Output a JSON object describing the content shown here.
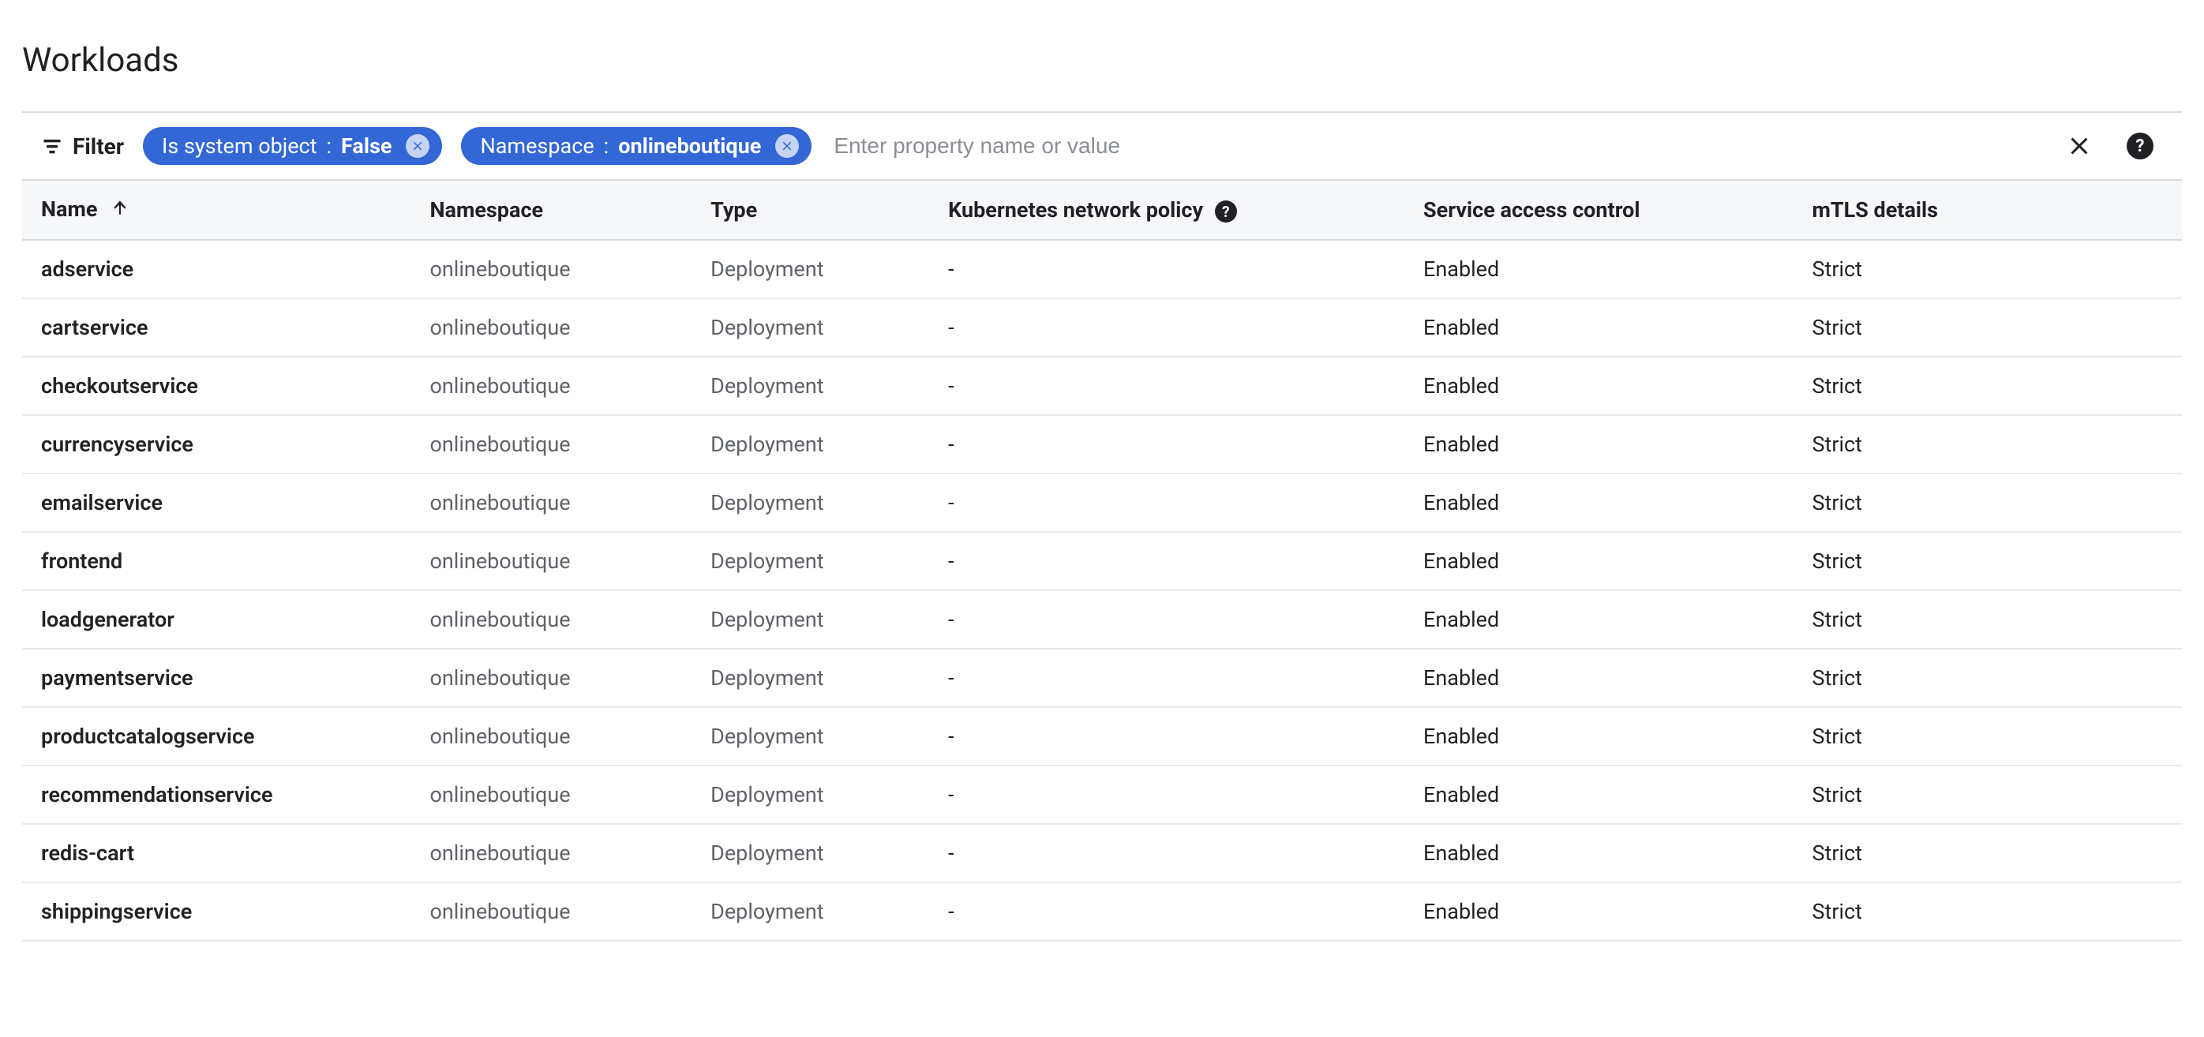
{
  "title": "Workloads",
  "filter": {
    "label": "Filter",
    "input_placeholder": "Enter property name or value",
    "chips": [
      {
        "key": "Is system object",
        "value": "False"
      },
      {
        "key": "Namespace",
        "value": "onlineboutique"
      }
    ]
  },
  "columns": {
    "name": "Name",
    "namespace": "Namespace",
    "type": "Type",
    "netpol": "Kubernetes network policy",
    "access": "Service access control",
    "mtls": "mTLS details"
  },
  "rows": [
    {
      "name": "adservice",
      "namespace": "onlineboutique",
      "type": "Deployment",
      "netpol": "-",
      "access": "Enabled",
      "mtls": "Strict"
    },
    {
      "name": "cartservice",
      "namespace": "onlineboutique",
      "type": "Deployment",
      "netpol": "-",
      "access": "Enabled",
      "mtls": "Strict"
    },
    {
      "name": "checkoutservice",
      "namespace": "onlineboutique",
      "type": "Deployment",
      "netpol": "-",
      "access": "Enabled",
      "mtls": "Strict"
    },
    {
      "name": "currencyservice",
      "namespace": "onlineboutique",
      "type": "Deployment",
      "netpol": "-",
      "access": "Enabled",
      "mtls": "Strict"
    },
    {
      "name": "emailservice",
      "namespace": "onlineboutique",
      "type": "Deployment",
      "netpol": "-",
      "access": "Enabled",
      "mtls": "Strict"
    },
    {
      "name": "frontend",
      "namespace": "onlineboutique",
      "type": "Deployment",
      "netpol": "-",
      "access": "Enabled",
      "mtls": "Strict"
    },
    {
      "name": "loadgenerator",
      "namespace": "onlineboutique",
      "type": "Deployment",
      "netpol": "-",
      "access": "Enabled",
      "mtls": "Strict"
    },
    {
      "name": "paymentservice",
      "namespace": "onlineboutique",
      "type": "Deployment",
      "netpol": "-",
      "access": "Enabled",
      "mtls": "Strict"
    },
    {
      "name": "productcatalogservice",
      "namespace": "onlineboutique",
      "type": "Deployment",
      "netpol": "-",
      "access": "Enabled",
      "mtls": "Strict"
    },
    {
      "name": "recommendationservice",
      "namespace": "onlineboutique",
      "type": "Deployment",
      "netpol": "-",
      "access": "Enabled",
      "mtls": "Strict"
    },
    {
      "name": "redis-cart",
      "namespace": "onlineboutique",
      "type": "Deployment",
      "netpol": "-",
      "access": "Enabled",
      "mtls": "Strict"
    },
    {
      "name": "shippingservice",
      "namespace": "onlineboutique",
      "type": "Deployment",
      "netpol": "-",
      "access": "Enabled",
      "mtls": "Strict"
    }
  ]
}
